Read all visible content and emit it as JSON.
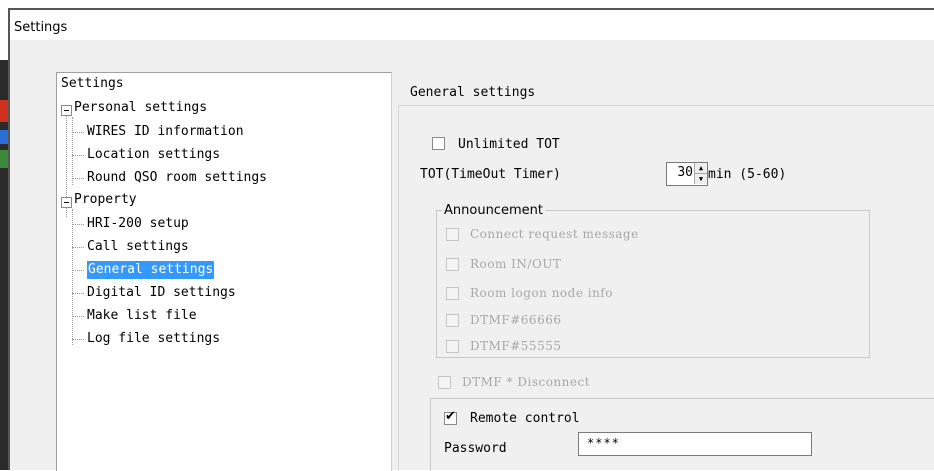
{
  "window": {
    "title": "Settings"
  },
  "tree": {
    "root": "Settings",
    "groups": [
      {
        "label": "Personal settings",
        "items": [
          "WIRES ID information",
          "Location settings",
          "Round QSO room settings"
        ]
      },
      {
        "label": "Property",
        "items": [
          "HRI-200 setup",
          "Call settings",
          "General settings",
          "Digital ID settings",
          "Make list file",
          "Log file settings"
        ]
      }
    ]
  },
  "panel": {
    "title": "General settings",
    "unlimited_tot": {
      "label": "Unlimited TOT",
      "checked": false
    },
    "tot": {
      "label": "TOT(TimeOut Timer)",
      "value": "30",
      "unit": "min (5-60)"
    },
    "announcement": {
      "legend": "Announcement",
      "options": [
        "Connect request message",
        "Room IN/OUT",
        "Room logon node info",
        "DTMF#66666",
        "DTMF#55555"
      ]
    },
    "dtmf_disconnect": {
      "label": "DTMF * Disconnect"
    },
    "remote_control": {
      "label": "Remote control",
      "checked_mark": "✔"
    },
    "password": {
      "label": "Password",
      "value": "****"
    }
  }
}
